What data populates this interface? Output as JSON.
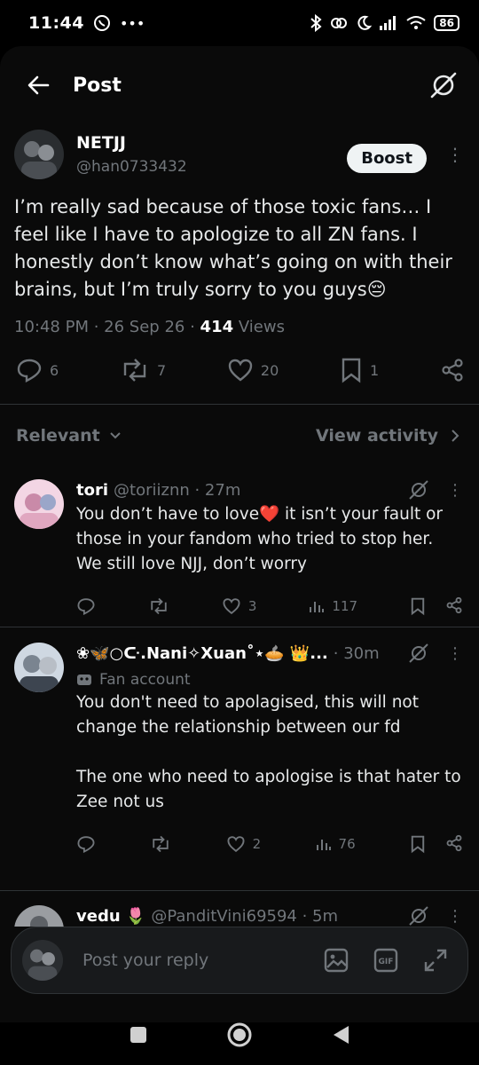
{
  "status": {
    "time": "11:44",
    "battery": "86"
  },
  "header": {
    "title": "Post"
  },
  "post": {
    "author_name": "NETJJ",
    "author_handle": "@han0733432",
    "boost_label": "Boost",
    "text": "I’m really sad because of those toxic fans… I feel like I have to apologize to all ZN fans. I honestly don’t know what’s going on with their brains, but I’m truly sorry to you guys😔",
    "time": "10:48 PM",
    "date": "26 Sep 26",
    "views_count": "414",
    "views_label": "Views",
    "replies": "6",
    "reposts": "7",
    "likes": "20",
    "bookmarks": "1"
  },
  "filter": {
    "sort_label": "Relevant",
    "view_activity_label": "View activity"
  },
  "replies": [
    {
      "name": "tori",
      "handle": "@toriiznn · 27m",
      "text": "You don’t have to love❤️ it isn’t your fault or those in your fandom who tried to stop her. We still love NJJ, don’t worry",
      "replies": "",
      "reposts": "",
      "likes": "3",
      "views": "117"
    },
    {
      "name": "❀🦋○ᑢ.Nani✧Xuan˚⋆🥧 👑...",
      "handle": "· 30m",
      "fan_label": "Fan account",
      "text_1": "You don't need to apolagised, this will not change the relationship between our fd",
      "text_2": "The one who need to apologise is that hater to Zee not us",
      "likes": "2",
      "views": "76"
    },
    {
      "name": "vedu 🌷",
      "handle": "@PanditVini69594 · 5m"
    }
  ],
  "composer": {
    "placeholder": "Post your reply"
  },
  "colors": {
    "background": "#000000",
    "text": "#e7e9ea",
    "muted": "#71767b",
    "boost_bg": "#eff3f4"
  }
}
